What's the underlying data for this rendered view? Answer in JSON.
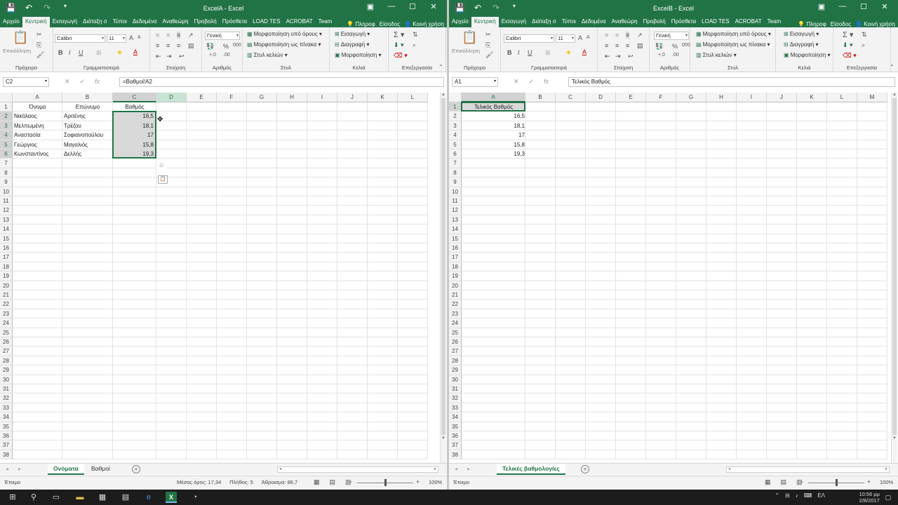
{
  "windowA": {
    "title": "ExcelA - Excel",
    "tabs": [
      "Αρχείο",
      "Κεντρική",
      "Εισαγωγή",
      "Διάταξη σ",
      "Τύποι",
      "Δεδομένα",
      "Αναθεώρη",
      "Προβολή",
      "Πρόσθετα",
      "LOAD TES",
      "ACROBAT",
      "Team"
    ],
    "active_tab": "Κεντρική",
    "tell_me": "Πληροφ",
    "sign_in": "Είσοδος",
    "share": "Κοινή χρήση",
    "ribbon": {
      "paste_label": "Επικόλληση",
      "font_name": "Calibri",
      "font_size": "11",
      "number_format": "Γενική",
      "conditional_formatting": "Μορφοποίηση υπό όρους",
      "format_as_table": "Μορφοποίηση ως πίνακα",
      "cell_styles": "Στυλ κελιών",
      "insert": "Εισαγωγή",
      "delete": "Διαγραφή",
      "format": "Μορφοποίηση",
      "groups": [
        "Πρόχειρο",
        "Γραμματοσειρά",
        "Στοίχιση",
        "Αριθμός",
        "Στυλ",
        "Κελιά",
        "Επεξεργασία"
      ]
    },
    "name_box": "C2",
    "formula": "=Βαθμοί!A2",
    "columns": [
      "A",
      "B",
      "C",
      "D",
      "E",
      "F",
      "G",
      "H",
      "I",
      "J",
      "K",
      "L"
    ],
    "rows": [
      "1",
      "2",
      "3",
      "4",
      "5",
      "6",
      "7",
      "8",
      "9",
      "10",
      "11",
      "12",
      "13",
      "14",
      "15",
      "16",
      "17",
      "18",
      "19",
      "20",
      "21",
      "22",
      "23",
      "24",
      "25",
      "26",
      "27",
      "28",
      "29",
      "30",
      "31",
      "32",
      "33",
      "34",
      "35",
      "36",
      "37",
      "38"
    ],
    "cells": [
      [
        "Όνομα",
        "Επώνυμο",
        "Βαθμός"
      ],
      [
        "Νικόλαος",
        "Αρσένης",
        "16,5"
      ],
      [
        "Μελπωμένη",
        "Τρέζου",
        "18,1"
      ],
      [
        "Αναστασία",
        "Σοφιανοπούλου",
        "17"
      ],
      [
        "Γεώργιος",
        "Μαγαλιός",
        "15,8"
      ],
      [
        "Κωνσταντίνος",
        "Δελλής",
        "19,3"
      ]
    ],
    "sheets": [
      "Ονόματα",
      "Βαθμοί"
    ],
    "active_sheet": "Ονόματα",
    "status": {
      "ready": "Έτοιμο",
      "average": "Μέσος όρος: 17,34",
      "count": "Πλήθος: 5",
      "sum": "Άθροισμα: 86,7",
      "zoom": "100%",
      "zoom_level": 0.5
    }
  },
  "windowB": {
    "title": "ExcelB - Excel",
    "tabs": [
      "Αρχείο",
      "Κεντρική",
      "Εισαγωγή",
      "Διάταξη σ",
      "Τύποι",
      "Δεδομένα",
      "Αναθεώρη",
      "Προβολή",
      "Πρόσθετα",
      "LOAD TES",
      "ACROBAT",
      "Team"
    ],
    "active_tab": "Κεντρική",
    "tell_me": "Πληροφ",
    "sign_in": "Είσοδος",
    "share": "Κοινή χρήση",
    "ribbon": {
      "paste_label": "Επικόλληση",
      "font_name": "Calibri",
      "font_size": "11",
      "number_format": "Γενική",
      "conditional_formatting": "Μορφοποίηση υπό όρους",
      "format_as_table": "Μορφοποίηση ως πίνακα",
      "cell_styles": "Στυλ κελιών",
      "insert": "Εισαγωγή",
      "delete": "Διαγραφή",
      "format": "Μορφοποίηση",
      "groups": [
        "Πρόχειρο",
        "Γραμματοσειρά",
        "Στοίχιση",
        "Αριθμός",
        "Στυλ",
        "Κελιά",
        "Επεξεργασία"
      ]
    },
    "name_box": "A1",
    "formula": "Τελικός Βαθμός",
    "columns": [
      "A",
      "B",
      "C",
      "D",
      "E",
      "F",
      "G",
      "H",
      "I",
      "J",
      "K",
      "L",
      "M"
    ],
    "rows": [
      "1",
      "2",
      "3",
      "4",
      "5",
      "6",
      "7",
      "8",
      "9",
      "10",
      "11",
      "12",
      "13",
      "14",
      "15",
      "16",
      "17",
      "18",
      "19",
      "20",
      "21",
      "22",
      "23",
      "24",
      "25",
      "26",
      "27",
      "28",
      "29",
      "30",
      "31",
      "32",
      "33",
      "34",
      "35",
      "36",
      "37",
      "38"
    ],
    "cells": [
      [
        "Τελικός Βαθμός"
      ],
      [
        "16,5"
      ],
      [
        "18,1"
      ],
      [
        "17"
      ],
      [
        "15,8"
      ],
      [
        "19,3"
      ]
    ],
    "sheets": [
      "Τελικές βαθμολογίες"
    ],
    "active_sheet": "Τελικές βαθμολογίες",
    "status": {
      "ready": "Έτοιμο",
      "zoom": "100%",
      "zoom_level": 0.5
    }
  },
  "taskbar": {
    "language": "ΕΛ",
    "time": "10:56 μμ",
    "date": "2/8/2017"
  },
  "colors": {
    "excel_green": "#217346",
    "taskbar": "#1c1c1c"
  }
}
